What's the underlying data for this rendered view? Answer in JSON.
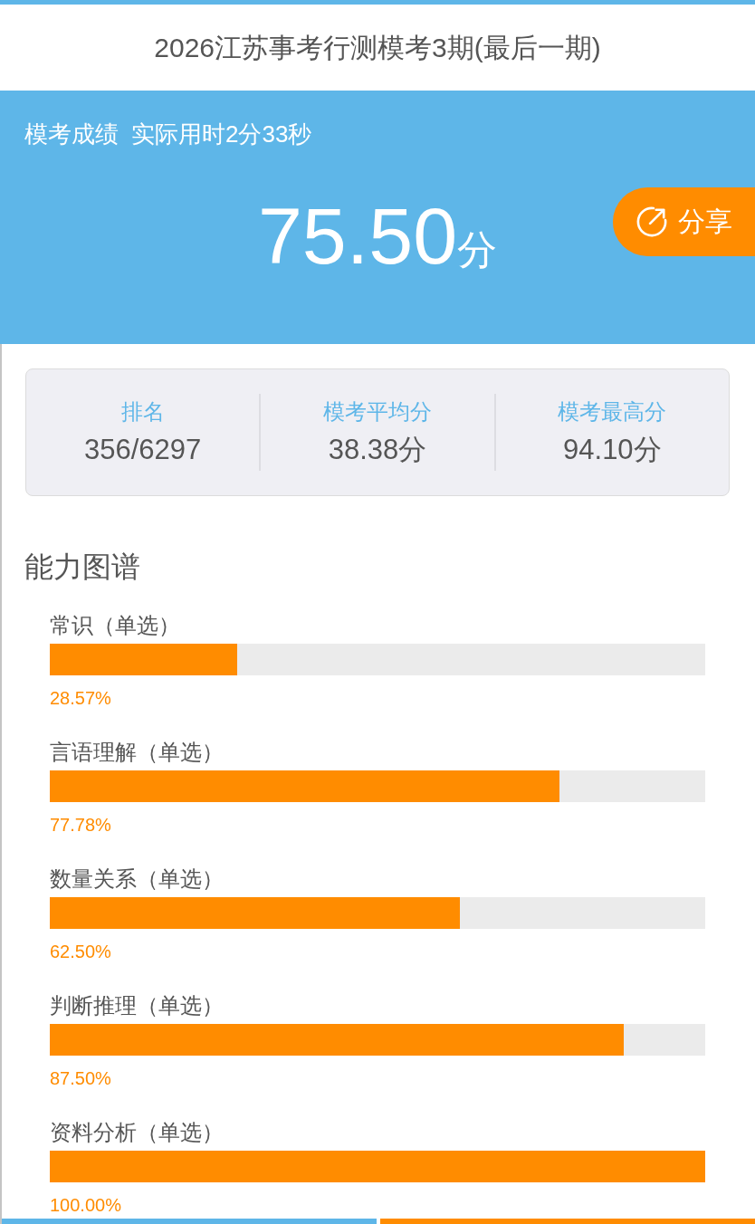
{
  "header": {
    "title": "2026江苏事考行测模考3期(最后一期)"
  },
  "score_panel": {
    "label": "模考成绩",
    "time_used": "实际用时2分33秒",
    "score": "75.50",
    "unit": "分",
    "share_button": {
      "label": "分享"
    }
  },
  "stats": [
    {
      "label": "排名",
      "value": "356/6297"
    },
    {
      "label": "模考平均分",
      "value": "38.38分"
    },
    {
      "label": "模考最高分",
      "value": "94.10分"
    }
  ],
  "ability": {
    "title": "能力图谱",
    "items": [
      {
        "label": "常识（单选）",
        "level": 0.2857,
        "reading": "28.57%"
      },
      {
        "label": "言语理解（单选）",
        "level": 0.7778,
        "reading": "77.78%"
      },
      {
        "label": "数量关系（单选）",
        "level": 0.625,
        "reading": "62.50%"
      },
      {
        "label": "判断推理（单选）",
        "level": 0.875,
        "reading": "87.50%"
      },
      {
        "label": "资料分析（单选）",
        "level": 1.0,
        "reading": "100.00%"
      }
    ]
  }
}
